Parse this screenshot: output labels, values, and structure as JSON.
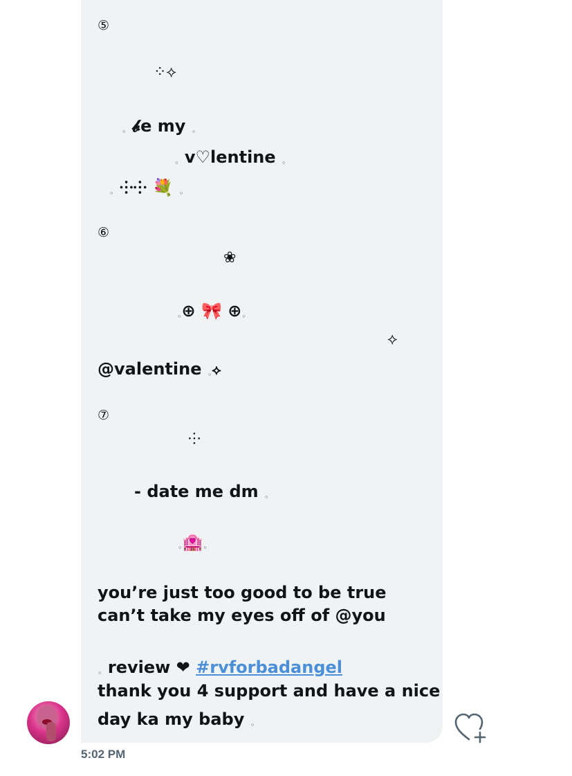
{
  "message": {
    "n5": "⑤",
    "sym1": "⁘⟡",
    "l_be": "𝓫e my",
    "l_valentine": "v♡lentine",
    "l_flowers": "⸭⸭ 💐",
    "n6": "⑥",
    "sym_flower": "❀",
    "l_bow_row": "⊕   🎀   ⊕",
    "sym2": "⟡",
    "l_at_valentine": "@valentine",
    "sym3": "⟡",
    "n7": "⑦",
    "sym4": "⸭",
    "l_date": "- date me dm",
    "l_house": "🏩",
    "line1": "you’re just too good to be true",
    "line2": "can’t take my eyes off of @you",
    "review_label": "review ❤",
    "hashtag": "#rvforbadangel",
    "line3": "thank you 4 support and have a nice",
    "line4": "day ka my baby"
  },
  "timestamp": "5:02 PM",
  "colors": {
    "bubble": "#eff3f4",
    "link": "#4a8fd8",
    "meta": "#536471"
  },
  "icons": {
    "react": "heart-plus-icon",
    "avatar": "user-avatar"
  }
}
